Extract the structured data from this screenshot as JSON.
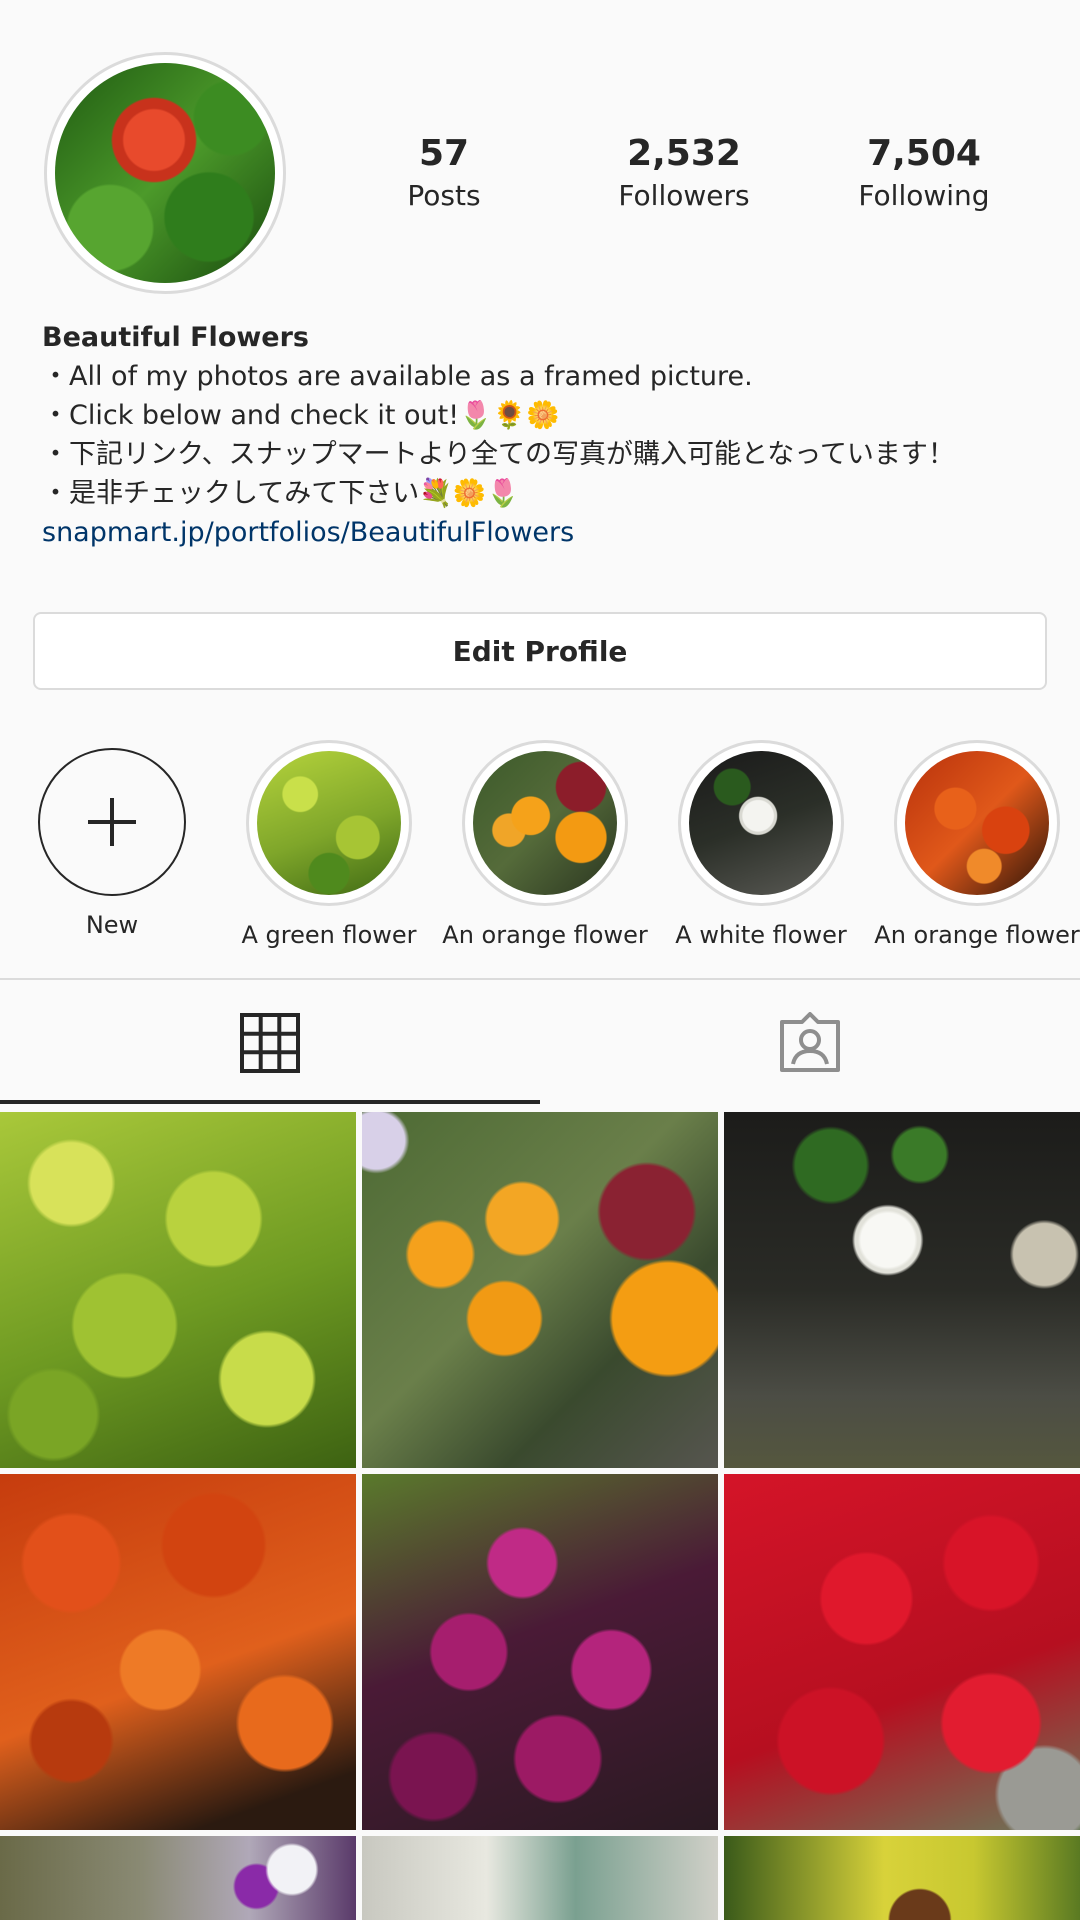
{
  "profile": {
    "stats": [
      {
        "number": "57",
        "label": "Posts"
      },
      {
        "number": "2,532",
        "label": "Followers"
      },
      {
        "number": "7,504",
        "label": "Following"
      }
    ],
    "name": "Beautiful Flowers",
    "bio_lines": [
      "・All of my photos are available as a framed picture.",
      "・Click below and check it out!🌷🌻🌼",
      "・下記リンク、スナップマートより全ての写真が購入可能となっています！",
      "・是非チェックしてみて下さい💐🌼🌷"
    ],
    "link": "snapmart.jp/portfolios/BeautifulFlowers",
    "edit_button": "Edit Profile"
  },
  "highlights": [
    {
      "label": "New",
      "icon": "plus-icon"
    },
    {
      "label": "A green flower"
    },
    {
      "label": "An orange flower"
    },
    {
      "label": "A white flower"
    },
    {
      "label": "An orange flower"
    }
  ],
  "tabs": [
    {
      "icon": "grid-icon",
      "active": true
    },
    {
      "icon": "tagged-icon",
      "active": false
    }
  ],
  "colors": {
    "link": "#003569",
    "text": "#262626",
    "border": "#dbdbdb",
    "background": "#fafafa"
  }
}
